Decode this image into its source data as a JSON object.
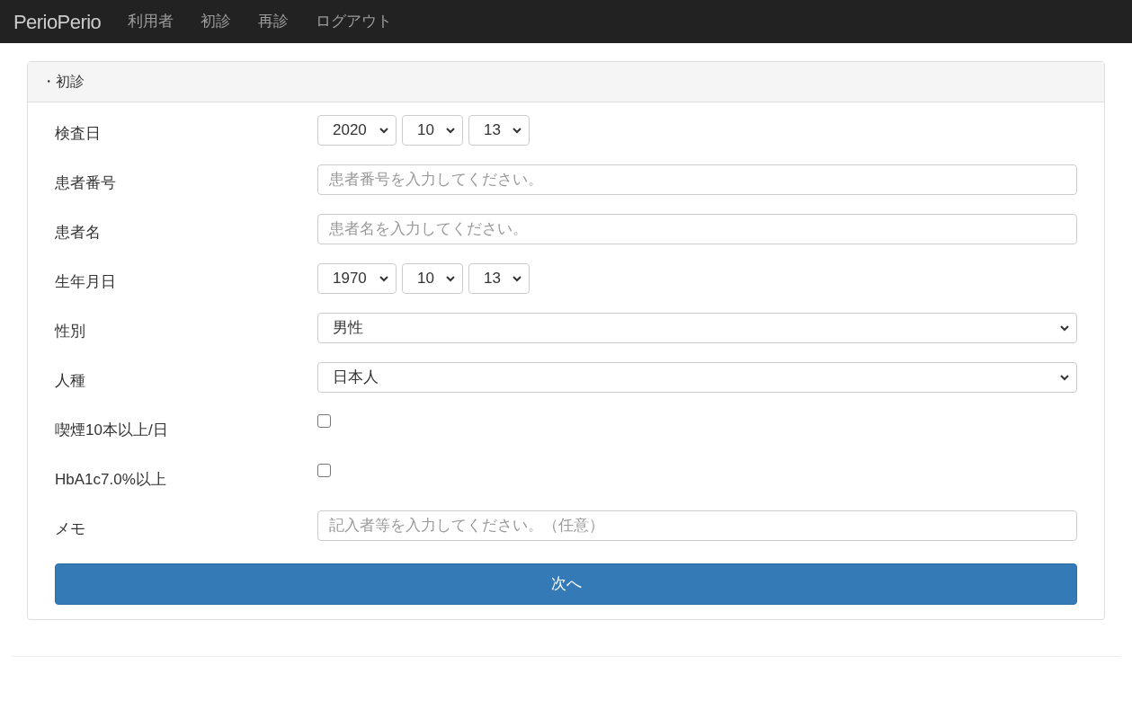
{
  "navbar": {
    "brand": "PerioPerio",
    "links": [
      "利用者",
      "初診",
      "再診",
      "ログアウト"
    ]
  },
  "panel": {
    "title": "・初診",
    "fields": [
      {
        "kind": "date",
        "label": "検査日",
        "values": [
          "2020",
          "10",
          "13"
        ]
      },
      {
        "kind": "text",
        "label": "患者番号",
        "placeholder": "患者番号を入力してください。"
      },
      {
        "kind": "text",
        "label": "患者名",
        "placeholder": "患者名を入力してください。"
      },
      {
        "kind": "date",
        "label": "生年月日",
        "values": [
          "1970",
          "10",
          "13"
        ]
      },
      {
        "kind": "select",
        "label": "性別",
        "value": "男性"
      },
      {
        "kind": "select",
        "label": "人種",
        "value": "日本人"
      },
      {
        "kind": "checkbox",
        "label": "喫煙10本以上/日",
        "checked": false
      },
      {
        "kind": "checkbox",
        "label": "HbA1c7.0%以上",
        "checked": false
      },
      {
        "kind": "text",
        "label": "メモ",
        "placeholder": "記入者等を入力してください。（任意）"
      }
    ],
    "submit": "次へ"
  }
}
